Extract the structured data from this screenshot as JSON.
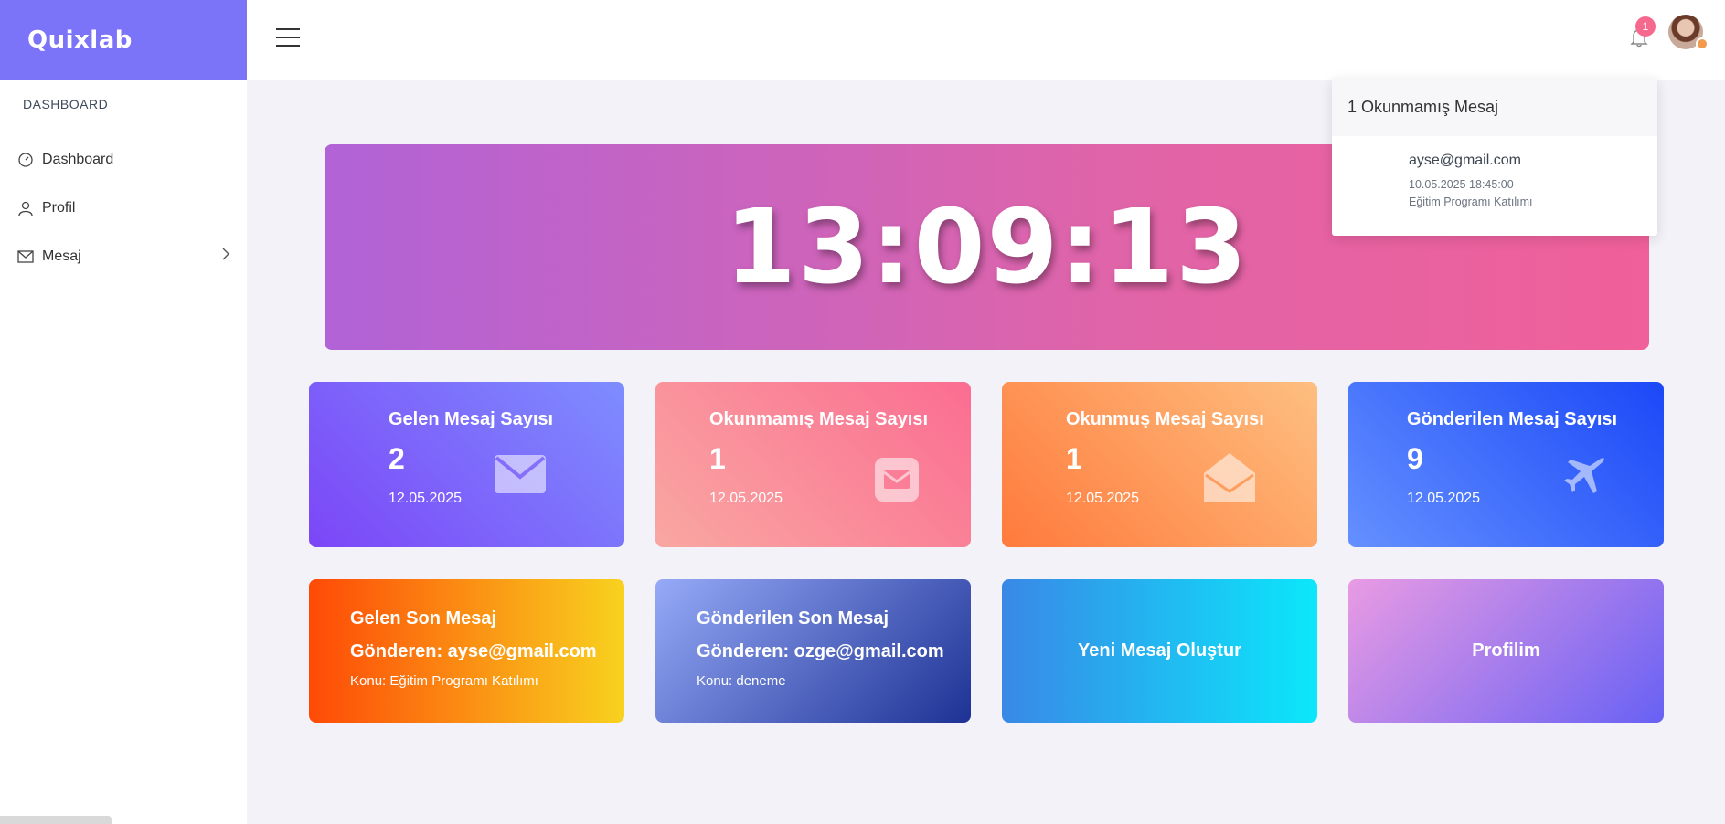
{
  "brand": "Quixlab",
  "sidebar": {
    "section_label": "DASHBOARD",
    "items": [
      {
        "label": "Dashboard",
        "icon": "speedometer-icon"
      },
      {
        "label": "Profil",
        "icon": "user-icon"
      },
      {
        "label": "Mesaj",
        "icon": "envelope-icon"
      }
    ]
  },
  "topbar": {
    "notification_count": "1"
  },
  "notifications": {
    "header": "1 Okunmamış Mesaj",
    "items": [
      {
        "sender": "ayse@gmail.com",
        "datetime": "10.05.2025 18:45:00",
        "subject": "Eğitim Programı Katılımı"
      }
    ]
  },
  "clock": "13:09:13",
  "stats": [
    {
      "title": "Gelen Mesaj Sayısı",
      "value": "2",
      "date": "12.05.2025",
      "icon": "envelope-icon"
    },
    {
      "title": "Okunmamış Mesaj Sayısı",
      "value": "1",
      "date": "12.05.2025",
      "icon": "envelope-square-icon"
    },
    {
      "title": "Okunmuş Mesaj Sayısı",
      "value": "1",
      "date": "12.05.2025",
      "icon": "envelope-open-icon"
    },
    {
      "title": "Gönderilen Mesaj Sayısı",
      "value": "9",
      "date": "12.05.2025",
      "icon": "plane-icon"
    }
  ],
  "last_received": {
    "title": "Gelen Son Mesaj",
    "sender": "Gönderen: ayse@gmail.com",
    "subject": "Konu: Eğitim Programı Katılımı"
  },
  "last_sent": {
    "title": "Gönderilen Son Mesaj",
    "sender": "Gönderen: ozge@gmail.com",
    "subject": "Konu: deneme"
  },
  "actions": {
    "new_message": "Yeni Mesaj Oluştur",
    "profile": "Profilim"
  },
  "colors": {
    "brand": "#7b73f8",
    "badge": "#f6698e"
  }
}
